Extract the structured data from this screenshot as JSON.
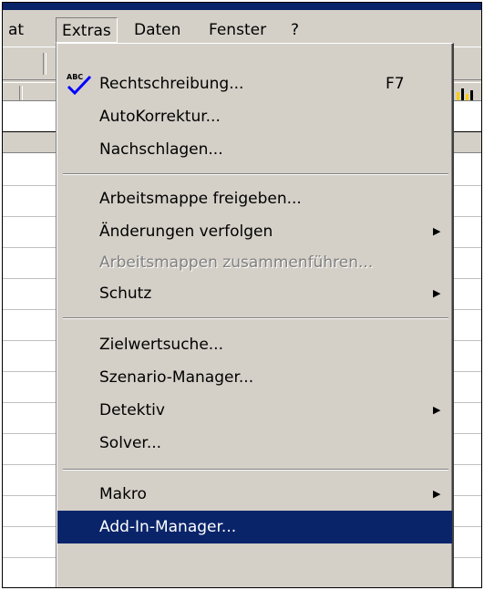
{
  "menubar": {
    "items": [
      {
        "label": "at"
      },
      {
        "label": "Extras"
      },
      {
        "label": "Daten"
      },
      {
        "label": "Fenster"
      },
      {
        "label": "?"
      }
    ]
  },
  "menu": {
    "items": [
      {
        "label": "Rechtschreibung...",
        "shortcut": "F7",
        "icon": "spellcheck-abc-icon"
      },
      {
        "label": "AutoKorrektur..."
      },
      {
        "label": "Nachschlagen..."
      },
      {
        "label": "Arbeitsmappe freigeben..."
      },
      {
        "label": "Änderungen verfolgen",
        "submenu": true
      },
      {
        "label": "Arbeitsmappen zusammenführen...",
        "disabled": true
      },
      {
        "label": "Schutz",
        "submenu": true
      },
      {
        "label": "Zielwertsuche..."
      },
      {
        "label": "Szenario-Manager..."
      },
      {
        "label": "Detektiv",
        "submenu": true
      },
      {
        "label": "Solver..."
      },
      {
        "label": "Makro",
        "submenu": true
      },
      {
        "label": "Add-In-Manager...",
        "highlighted": true
      }
    ],
    "submenu_arrow": "▶"
  },
  "colors": {
    "menu_bg": "#d4d0c8",
    "highlight": "#0a246a",
    "title_bar": "#0a246a",
    "disabled_text": "#808080"
  }
}
